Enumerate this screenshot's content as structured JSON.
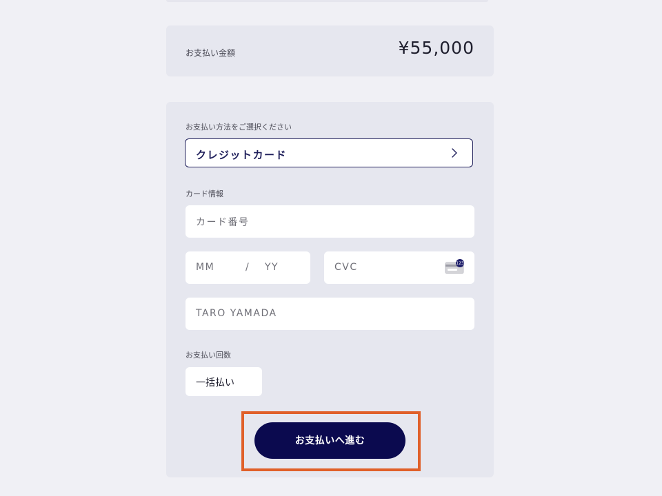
{
  "summary": {
    "label": "お支払い金額",
    "amount": "¥55,000"
  },
  "method": {
    "label": "お支払い方法をご選択ください",
    "selected": "クレジットカード"
  },
  "card": {
    "label": "カード情報",
    "number_placeholder": "カード番号",
    "month_placeholder": "MM",
    "separator": "/",
    "year_placeholder": "YY",
    "cvc_placeholder": "CVC",
    "cvc_icon_text": "123",
    "name_placeholder": "TARO YAMADA"
  },
  "installments": {
    "label": "お支払い回数",
    "selected": "一括払い"
  },
  "submit": {
    "label": "お支払いへ進む"
  },
  "colors": {
    "accent": "#0b0a4f",
    "highlight": "#e0602a",
    "card_bg": "#e6e7ef",
    "page_bg": "#f0f0f5"
  },
  "icons": {
    "method_chevron": "chevron-right-icon",
    "cvc": "credit-card-cvc-icon"
  }
}
